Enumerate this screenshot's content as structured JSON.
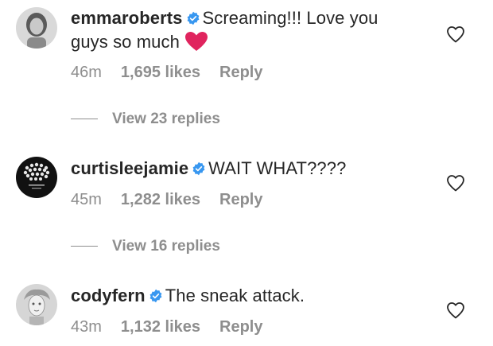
{
  "comments": [
    {
      "username": "emmaroberts",
      "text_line1": "Screaming!!! Love you",
      "text_line2": "guys so much",
      "time": "46m",
      "likes": "1,695 likes",
      "reply": "Reply",
      "view_replies": "View 23 replies"
    },
    {
      "username": "curtisleejamie",
      "text": "WAIT WHAT????",
      "time": "45m",
      "likes": "1,282 likes",
      "reply": "Reply",
      "view_replies": "View 16 replies"
    },
    {
      "username": "codyfern",
      "text": "The sneak attack.",
      "time": "43m",
      "likes": "1,132 likes",
      "reply": "Reply"
    }
  ],
  "colors": {
    "verified": "#3897f0",
    "meta": "#8e8e8e",
    "text": "#262626",
    "emoji_heart": "#e0245e"
  },
  "icons": {
    "verified": "verified-badge-icon",
    "like": "heart-outline-icon",
    "emoji": "red-heart-emoji"
  }
}
